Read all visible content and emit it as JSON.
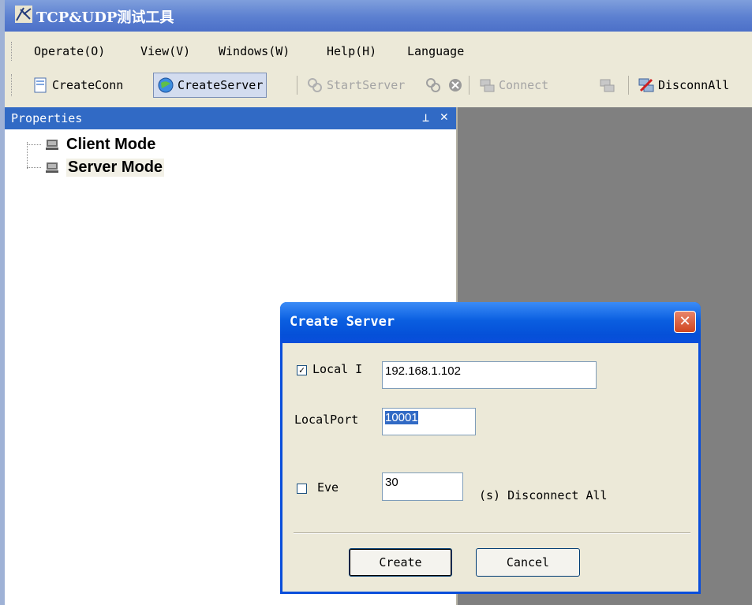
{
  "app": {
    "title": "TCP&UDP测试工具"
  },
  "menu": [
    "Operate(O)",
    "View(V)",
    "Windows(W)",
    "Help(H)",
    "Language"
  ],
  "toolbar": {
    "create_conn": "CreateConn",
    "create_server": "CreateServer",
    "start_server": "StartServer",
    "connect": "Connect",
    "disconn_all": "DisconnAll"
  },
  "properties": {
    "title": "Properties",
    "pin_glyph": "⊥",
    "close_glyph": "✕",
    "tree": [
      {
        "label": "Client Mode"
      },
      {
        "label": "Server Mode"
      }
    ]
  },
  "dialog": {
    "title": "Create Server",
    "close_glyph": "✕",
    "local_ip_label": "Local I",
    "local_ip_checked": true,
    "local_ip_value": "192.168.1.102",
    "local_port_label": "LocalPort",
    "local_port_value": "10001",
    "every_label": "Eve",
    "every_checked": false,
    "every_value": "30",
    "disconnect_suffix": "(s) Disconnect All",
    "create_label": "Create",
    "cancel_label": "Cancel"
  },
  "colors": {
    "title_blue": "#0a5ee0",
    "selection": "#316ac5",
    "mdi_gray": "#808080",
    "face": "#ece9d8"
  }
}
